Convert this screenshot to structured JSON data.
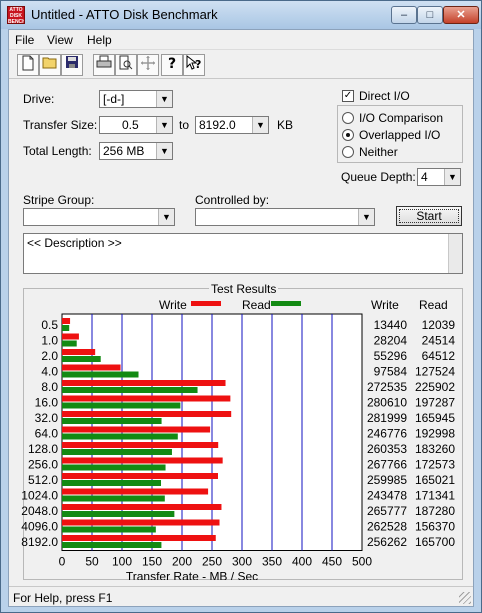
{
  "window": {
    "title": "Untitled - ATTO Disk Benchmark",
    "icon_label": "ATTO DISK BENCH",
    "caption": {
      "min": "–",
      "max": "□",
      "close": "✕"
    }
  },
  "menu": [
    "File",
    "View",
    "Help"
  ],
  "toolbar_icons": [
    "new-icon",
    "open-icon",
    "save-icon",
    "print-icon",
    "print-preview-icon",
    "move-icon",
    "help-icon",
    "context-help-icon"
  ],
  "form": {
    "drive_label": "Drive:",
    "drive_value": "[-d-]",
    "transfer_size_label": "Transfer Size:",
    "transfer_from": "0.5",
    "to_label": "to",
    "transfer_to": "8192.0",
    "kb_label": "KB",
    "total_length_label": "Total Length:",
    "total_length_value": "256 MB",
    "direct_io_label": "Direct I/O",
    "io_comparison_label": "I/O Comparison",
    "overlapped_io_label": "Overlapped I/O",
    "neither_label": "Neither",
    "queue_depth_label": "Queue Depth:",
    "queue_depth_value": "4",
    "stripe_group_label": "Stripe Group:",
    "stripe_group_value": "",
    "controlled_by_label": "Controlled by:",
    "controlled_by_value": "",
    "start_label": "Start",
    "description_text": "<< Description >>"
  },
  "results": {
    "title": "Test Results",
    "legend_write": "Write",
    "legend_read": "Read",
    "col_write": "Write",
    "col_read": "Read"
  },
  "colors": {
    "write": "#ee1111",
    "read": "#138a13",
    "grid": "#1010c0"
  },
  "chart_data": {
    "type": "bar",
    "title": "Test Results",
    "xlabel": "Transfer Rate - MB / Sec",
    "ylabel": "",
    "xlim": [
      0,
      500
    ],
    "x_ticks": [
      "0",
      "50",
      "100",
      "150",
      "200",
      "250",
      "300",
      "350",
      "400",
      "450",
      "500"
    ],
    "categories": [
      "0.5",
      "1.0",
      "2.0",
      "4.0",
      "8.0",
      "16.0",
      "32.0",
      "64.0",
      "128.0",
      "256.0",
      "512.0",
      "1024.0",
      "2048.0",
      "4096.0",
      "8192.0"
    ],
    "series": [
      {
        "name": "Write",
        "values": [
          13.44,
          28.204,
          55.296,
          97.584,
          272.535,
          280.61,
          281.999,
          246.776,
          260.353,
          267.766,
          259.985,
          243.478,
          265.777,
          262.528,
          256.262
        ],
        "labels": [
          "13440",
          "28204",
          "55296",
          "97584",
          "272535",
          "280610",
          "281999",
          "246776",
          "260353",
          "267766",
          "259985",
          "243478",
          "265777",
          "262528",
          "256262"
        ]
      },
      {
        "name": "Read",
        "values": [
          12.039,
          24.514,
          64.512,
          127.524,
          225.902,
          197.287,
          165.945,
          192.998,
          183.26,
          172.573,
          165.021,
          171.341,
          187.28,
          156.37,
          165.7
        ],
        "labels": [
          "12039",
          "24514",
          "64512",
          "127524",
          "225902",
          "197287",
          "165945",
          "192998",
          "183260",
          "172573",
          "165021",
          "171341",
          "187280",
          "156370",
          "165700"
        ]
      }
    ]
  },
  "status": {
    "text": "For Help, press F1"
  }
}
